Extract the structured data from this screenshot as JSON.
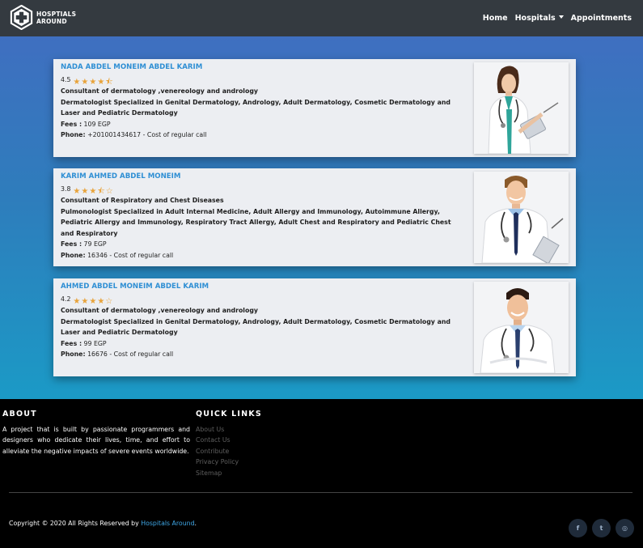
{
  "brand": {
    "line1": "HOSPTIALS",
    "line2": "AROUND"
  },
  "nav": {
    "home": "Home",
    "hospitals": "Hospitals",
    "appointments": "Appointments"
  },
  "doctors": [
    {
      "name": "NADA ABDEL MONEIM ABDEL KARIM",
      "rating": "4.5",
      "stars": 4.5,
      "title": "Consultant of dermatology ,venereology and andrology",
      "specialization": "Dermatologist Specialized in Genital Dermatology, Andrology, Adult Dermatology, Cosmetic Dermatology and Laser and Pediatric Dermatology",
      "fees_label": "Fees :",
      "fees": "109 EGP",
      "phone_label": "Phone:",
      "phone": "+201001434617 - Cost of regular call",
      "photo_icon": "female-doctor-photo"
    },
    {
      "name": "KARIM AHMED ABDEL MONEIM",
      "rating": "3.8",
      "stars": 3.5,
      "title": "Consultant of Respiratory and Chest Diseases",
      "specialization": "Pulmonologist Specialized in Adult Internal Medicine, Adult Allergy and Immunology, Autoimmune Allergy, Pediatric Allergy and Immunology, Respiratory Tract Allergy, Adult Chest and Respiratory and Pediatric Chest and Respiratory",
      "fees_label": "Fees :",
      "fees": "79 EGP",
      "phone_label": "Phone:",
      "phone": "16346 - Cost of regular call",
      "photo_icon": "male-doctor-photo"
    },
    {
      "name": "AHMED ABDEL MONEIM ABDEL KARIM",
      "rating": "4.2",
      "stars": 4,
      "title": "Consultant of dermatology ,venereology and andrology",
      "specialization": "Dermatologist Specialized in Genital Dermatology, Andrology, Adult Dermatology, Cosmetic Dermatology and Laser and Pediatric Dermatology",
      "fees_label": "Fees :",
      "fees": "99 EGP",
      "phone_label": "Phone:",
      "phone": "16676 - Cost of regular call",
      "photo_icon": "male-doctor-photo"
    }
  ],
  "footer": {
    "about_heading": "ABOUT",
    "about_text": "A project that is built by passionate programmers and designers who dedicate their lives, time, and effort to alleviate the negative impacts of severe events worldwide.",
    "links_heading": "QUICK LINKS",
    "links": [
      "About Us",
      "Contact Us",
      "Contribute",
      "Privacy Policy",
      "Sitemap"
    ],
    "copyright_prefix": "Copyright © 2020 All Rights Reserved by ",
    "copyright_link": "Hospitals Around",
    "copyright_suffix": ".",
    "socials": [
      {
        "icon": "facebook-icon",
        "glyph": "f"
      },
      {
        "icon": "twitter-icon",
        "glyph": "t"
      },
      {
        "icon": "dribbble-icon",
        "glyph": "◎"
      }
    ]
  },
  "colors": {
    "navbar": "#343a40",
    "accent": "#2f8fd4",
    "star": "#e8a33a",
    "footer": "#000000"
  }
}
